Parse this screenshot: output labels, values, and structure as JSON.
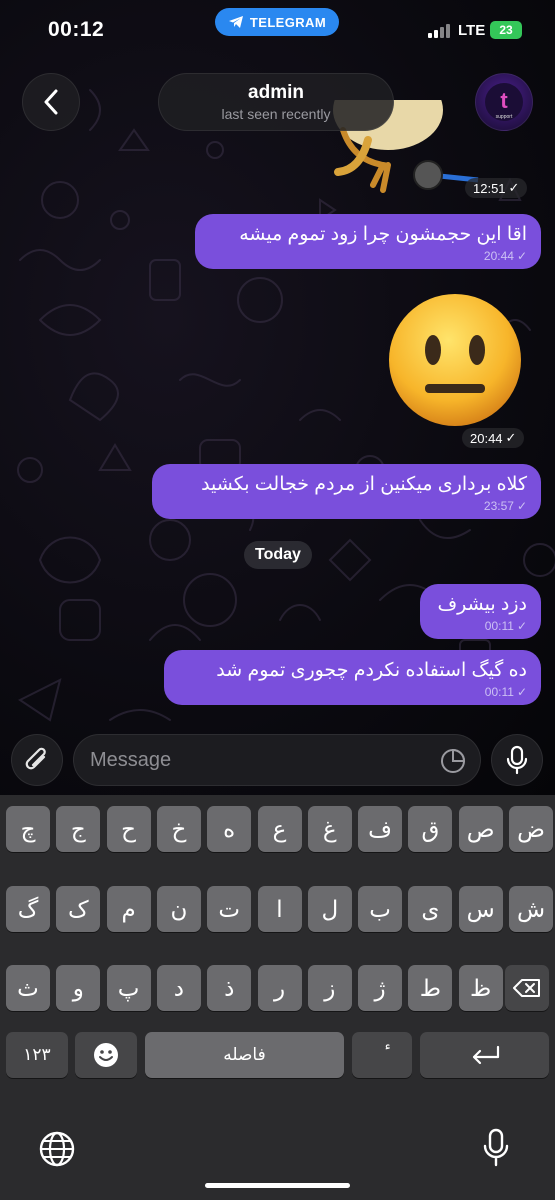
{
  "status_bar": {
    "time": "00:12",
    "telegram_label": "TELEGRAM",
    "network": "LTE",
    "battery": "23"
  },
  "header": {
    "name": "admin",
    "subtitle": "last seen recently",
    "avatar_glyph": "t",
    "avatar_caption": "support"
  },
  "messages": [
    {
      "type": "sticker",
      "time": "12:51"
    },
    {
      "type": "text",
      "text": "اقا این حجمشون چرا زود تموم میشه",
      "time": "20:44"
    },
    {
      "type": "emoji",
      "emoji": "😐",
      "time": "20:44"
    },
    {
      "type": "text",
      "text": "کلاه برداری میکنین از مردم خجالت بکشید",
      "time": "23:57"
    },
    {
      "type": "text",
      "text": "دزد بیشرف",
      "time": "00:11"
    },
    {
      "type": "text",
      "text": "ده گیگ استفاده نکردم چجوری تموم شد",
      "time": "00:11"
    }
  ],
  "date_separator": "Today",
  "composer": {
    "placeholder": "Message",
    "value": ""
  },
  "keyboard": {
    "row1": [
      "چ",
      "ج",
      "ح",
      "خ",
      "ه",
      "ع",
      "غ",
      "ف",
      "ق",
      "ص",
      "ض"
    ],
    "row2": [
      "گ",
      "ک",
      "م",
      "ن",
      "ت",
      "ا",
      "ل",
      "ب",
      "ی",
      "س",
      "ش"
    ],
    "row3": [
      "ث",
      "و",
      "پ",
      "د",
      "ذ",
      "ر",
      "ز",
      "ژ",
      "ط",
      "ظ"
    ],
    "numbers_key": "۱۲۳",
    "space_label": "فاصله",
    "mark_key": "ٔ"
  },
  "colors": {
    "bubble_out": "#7a4fdc",
    "telegram_blue": "#2a88f0",
    "battery_green": "#34c759"
  }
}
